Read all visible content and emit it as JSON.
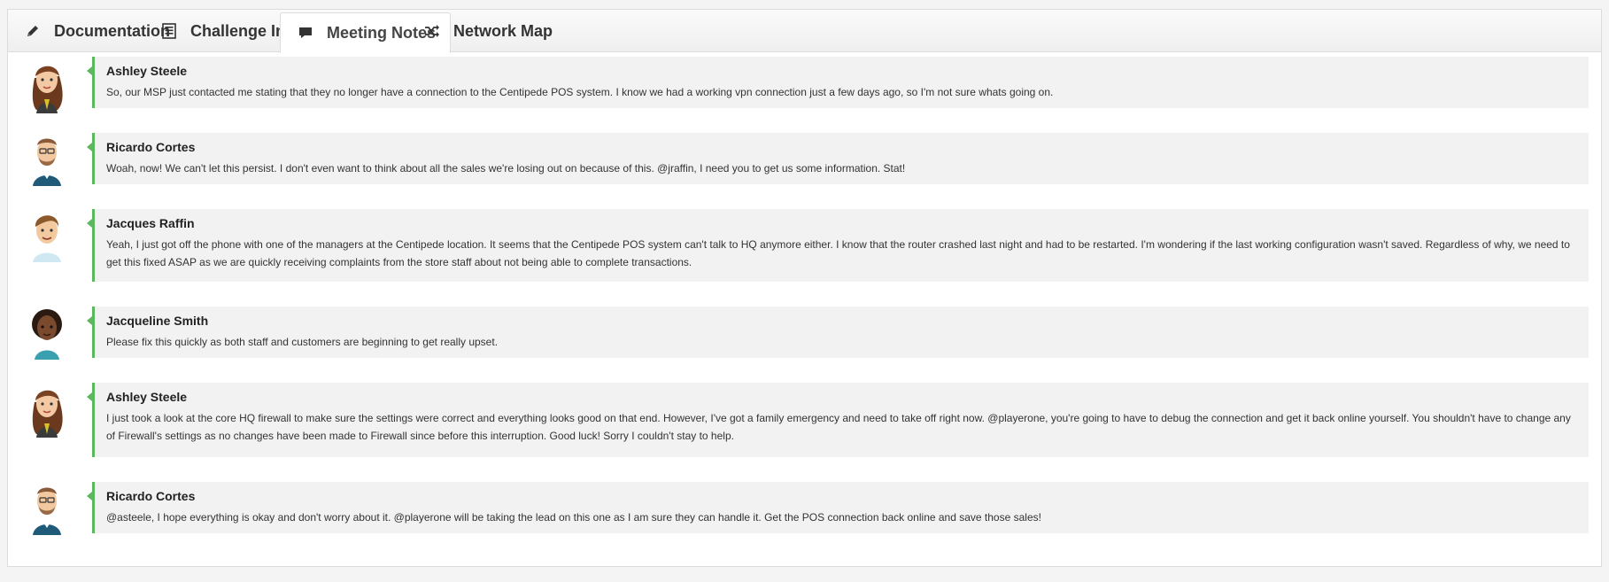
{
  "tabs": [
    {
      "label": "Documentation",
      "icon": "pencil-icon"
    },
    {
      "label": "Challenge Info",
      "icon": "list-icon"
    },
    {
      "label": "Meeting Notes",
      "icon": "comment-icon",
      "active": true
    },
    {
      "label": "Network Map",
      "icon": "shuffle-icon"
    }
  ],
  "colors": {
    "accent": "#5cb85c",
    "bubble_bg": "#f2f2f2"
  },
  "messages": [
    {
      "author": "Ashley Steele",
      "avatar": "avatar-ashley",
      "text": "So, our MSP just contacted me stating that they no longer have a connection to the Centipede POS system. I know we had a working vpn connection just a few days ago, so I'm not sure whats going on."
    },
    {
      "author": "Ricardo Cortes",
      "avatar": "avatar-ricardo",
      "text": "Woah, now! We can't let this persist. I don't even want to think about all the sales we're losing out on because of this. @jraffin, I need you to get us some information. Stat!"
    },
    {
      "author": "Jacques Raffin",
      "avatar": "avatar-jacques",
      "text": "Yeah, I just got off the phone with one of the managers at the Centipede location. It seems that the Centipede POS system can't talk to HQ anymore either. I know that the router crashed last night and had to be restarted. I'm wondering if the last working configuration wasn't saved. Regardless of why, we need to get this fixed ASAP as we are quickly receiving complaints from the store staff about not being able to complete transactions."
    },
    {
      "author": "Jacqueline Smith",
      "avatar": "avatar-jacqueline",
      "text": "Please fix this quickly as both staff and customers are beginning to get really upset."
    },
    {
      "author": "Ashley Steele",
      "avatar": "avatar-ashley",
      "text": "I just took a look at the core HQ firewall to make sure the settings were correct and everything looks good on that end. However, I've got a family emergency and need to take off right now. @playerone, you're going to have to debug the connection and get it back online yourself. You shouldn't have to change any of Firewall's settings as no changes have been made to Firewall since before this interruption. Good luck! Sorry I couldn't stay to help."
    },
    {
      "author": "Ricardo Cortes",
      "avatar": "avatar-ricardo",
      "text": "@asteele, I hope everything is okay and don't worry about it. @playerone will be taking the lead on this one as I am sure they can handle it. Get the POS connection back online and save those sales!"
    }
  ]
}
